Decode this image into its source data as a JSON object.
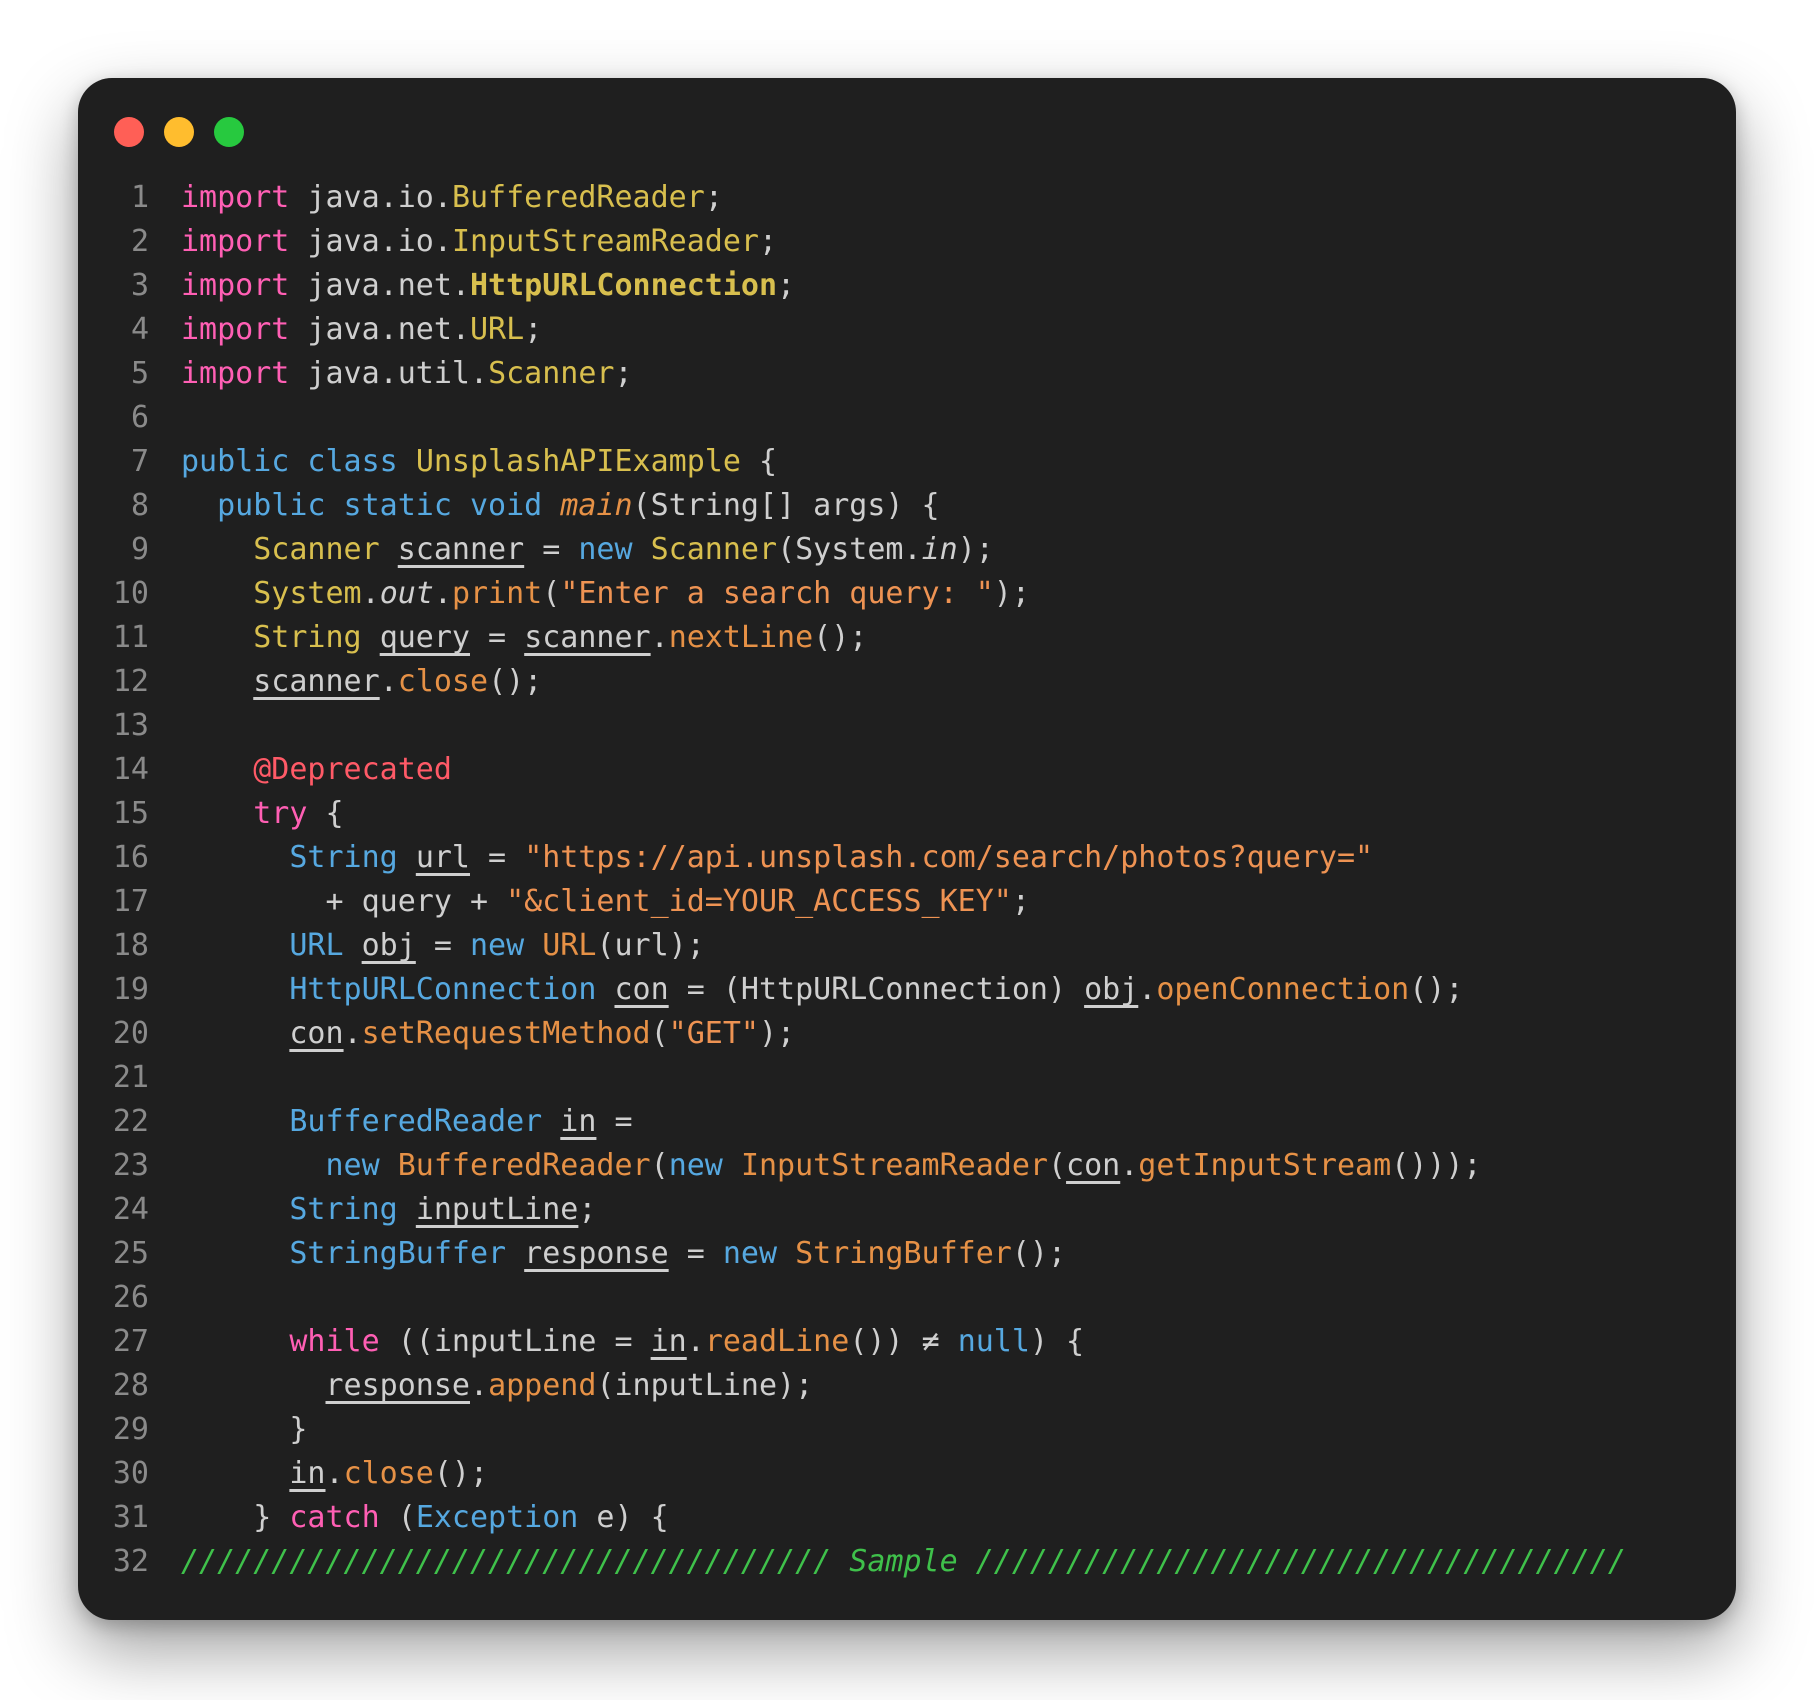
{
  "window": {
    "controls": [
      {
        "name": "close-button",
        "color": "#ff5f56"
      },
      {
        "name": "minimize-button",
        "color": "#ffbd2e"
      },
      {
        "name": "zoom-button",
        "color": "#27c93f"
      }
    ]
  },
  "colors": {
    "background": "#1f1f1f",
    "default": "#cfcfcf",
    "keyword": "#ff5fb4",
    "type_keyword": "#56a8e0",
    "class_name": "#d8bf4e",
    "method": "#e69146",
    "string": "#ee9353",
    "annotation": "#ff5a67",
    "comment": "#3fc14b",
    "line_number": "#8a8a8a"
  },
  "lines": [
    {
      "n": "1",
      "tokens": [
        {
          "t": "import",
          "c": "keyword"
        },
        {
          "t": " java.io.",
          "c": "default"
        },
        {
          "t": "BufferedReader",
          "c": "class_name"
        },
        {
          "t": ";",
          "c": "default"
        }
      ]
    },
    {
      "n": "2",
      "tokens": [
        {
          "t": "import",
          "c": "keyword"
        },
        {
          "t": " java.io.",
          "c": "default"
        },
        {
          "t": "InputStreamReader",
          "c": "class_name"
        },
        {
          "t": ";",
          "c": "default"
        }
      ]
    },
    {
      "n": "3",
      "tokens": [
        {
          "t": "import",
          "c": "keyword"
        },
        {
          "t": " java.net.",
          "c": "default"
        },
        {
          "t": "HttpURLConnection",
          "c": "class_name",
          "s": "b"
        },
        {
          "t": ";",
          "c": "default"
        }
      ]
    },
    {
      "n": "4",
      "tokens": [
        {
          "t": "import",
          "c": "keyword"
        },
        {
          "t": " java.net.",
          "c": "default"
        },
        {
          "t": "URL",
          "c": "class_name"
        },
        {
          "t": ";",
          "c": "default"
        }
      ]
    },
    {
      "n": "5",
      "tokens": [
        {
          "t": "import",
          "c": "keyword"
        },
        {
          "t": " java.util.",
          "c": "default"
        },
        {
          "t": "Scanner",
          "c": "class_name"
        },
        {
          "t": ";",
          "c": "default"
        }
      ]
    },
    {
      "n": "6",
      "tokens": []
    },
    {
      "n": "7",
      "tokens": [
        {
          "t": "public class ",
          "c": "type_keyword"
        },
        {
          "t": "UnsplashAPIExample",
          "c": "class_name"
        },
        {
          "t": " {",
          "c": "default"
        }
      ]
    },
    {
      "n": "8",
      "tokens": [
        {
          "t": "  public static void ",
          "c": "type_keyword"
        },
        {
          "t": "main",
          "c": "method",
          "s": "i"
        },
        {
          "t": "(String[] args) {",
          "c": "default"
        }
      ]
    },
    {
      "n": "9",
      "tokens": [
        {
          "t": "    Scanner ",
          "c": "class_name"
        },
        {
          "t": "scanner",
          "c": "default",
          "s": "u"
        },
        {
          "t": " = ",
          "c": "default"
        },
        {
          "t": "new ",
          "c": "type_keyword"
        },
        {
          "t": "Scanner",
          "c": "class_name"
        },
        {
          "t": "(System.",
          "c": "default"
        },
        {
          "t": "in",
          "c": "default",
          "s": "i"
        },
        {
          "t": ");",
          "c": "default"
        }
      ]
    },
    {
      "n": "10",
      "tokens": [
        {
          "t": "    System",
          "c": "class_name"
        },
        {
          "t": ".",
          "c": "default"
        },
        {
          "t": "out",
          "c": "default",
          "s": "i"
        },
        {
          "t": ".",
          "c": "default"
        },
        {
          "t": "print",
          "c": "method"
        },
        {
          "t": "(",
          "c": "default"
        },
        {
          "t": "\"Enter a search query: \"",
          "c": "string"
        },
        {
          "t": ");",
          "c": "default"
        }
      ]
    },
    {
      "n": "11",
      "tokens": [
        {
          "t": "    String ",
          "c": "class_name"
        },
        {
          "t": "query",
          "c": "default",
          "s": "u"
        },
        {
          "t": " = ",
          "c": "default"
        },
        {
          "t": "scanner",
          "c": "default",
          "s": "u"
        },
        {
          "t": ".",
          "c": "default"
        },
        {
          "t": "nextLine",
          "c": "method"
        },
        {
          "t": "();",
          "c": "default"
        }
      ]
    },
    {
      "n": "12",
      "tokens": [
        {
          "t": "    ",
          "c": "default"
        },
        {
          "t": "scanner",
          "c": "default",
          "s": "u"
        },
        {
          "t": ".",
          "c": "default"
        },
        {
          "t": "close",
          "c": "method"
        },
        {
          "t": "();",
          "c": "default"
        }
      ]
    },
    {
      "n": "13",
      "tokens": []
    },
    {
      "n": "14",
      "tokens": [
        {
          "t": "    @Deprecated",
          "c": "annotation"
        }
      ]
    },
    {
      "n": "15",
      "tokens": [
        {
          "t": "    try",
          "c": "keyword"
        },
        {
          "t": " {",
          "c": "default"
        }
      ]
    },
    {
      "n": "16",
      "tokens": [
        {
          "t": "      String ",
          "c": "type_keyword"
        },
        {
          "t": "url",
          "c": "default",
          "s": "u"
        },
        {
          "t": " = ",
          "c": "default"
        },
        {
          "t": "\"https://api.unsplash.com/search/photos?query=\"",
          "c": "string"
        }
      ]
    },
    {
      "n": "17",
      "tokens": [
        {
          "t": "        + query + ",
          "c": "default"
        },
        {
          "t": "\"&client_id=YOUR_ACCESS_KEY\"",
          "c": "string"
        },
        {
          "t": ";",
          "c": "default"
        }
      ]
    },
    {
      "n": "18",
      "tokens": [
        {
          "t": "      URL ",
          "c": "type_keyword"
        },
        {
          "t": "obj",
          "c": "default",
          "s": "u"
        },
        {
          "t": " = ",
          "c": "default"
        },
        {
          "t": "new ",
          "c": "type_keyword"
        },
        {
          "t": "URL",
          "c": "method"
        },
        {
          "t": "(url);",
          "c": "default"
        }
      ]
    },
    {
      "n": "19",
      "tokens": [
        {
          "t": "      HttpURLConnection ",
          "c": "type_keyword"
        },
        {
          "t": "con",
          "c": "default",
          "s": "u"
        },
        {
          "t": " = (HttpURLConnection) ",
          "c": "default"
        },
        {
          "t": "obj",
          "c": "default",
          "s": "u"
        },
        {
          "t": ".",
          "c": "default"
        },
        {
          "t": "openConnection",
          "c": "method"
        },
        {
          "t": "();",
          "c": "default"
        }
      ]
    },
    {
      "n": "20",
      "tokens": [
        {
          "t": "      ",
          "c": "default"
        },
        {
          "t": "con",
          "c": "default",
          "s": "u"
        },
        {
          "t": ".",
          "c": "default"
        },
        {
          "t": "setRequestMethod",
          "c": "method"
        },
        {
          "t": "(",
          "c": "default"
        },
        {
          "t": "\"GET\"",
          "c": "string"
        },
        {
          "t": ");",
          "c": "default"
        }
      ]
    },
    {
      "n": "21",
      "tokens": []
    },
    {
      "n": "22",
      "tokens": [
        {
          "t": "      BufferedReader ",
          "c": "type_keyword"
        },
        {
          "t": "in",
          "c": "default",
          "s": "u"
        },
        {
          "t": " =",
          "c": "default"
        }
      ]
    },
    {
      "n": "23",
      "tokens": [
        {
          "t": "        new ",
          "c": "type_keyword"
        },
        {
          "t": "BufferedReader",
          "c": "method"
        },
        {
          "t": "(",
          "c": "default"
        },
        {
          "t": "new ",
          "c": "type_keyword"
        },
        {
          "t": "InputStreamReader",
          "c": "method"
        },
        {
          "t": "(",
          "c": "default"
        },
        {
          "t": "con",
          "c": "default",
          "s": "u"
        },
        {
          "t": ".",
          "c": "default"
        },
        {
          "t": "getInputStream",
          "c": "method"
        },
        {
          "t": "()));",
          "c": "default"
        }
      ]
    },
    {
      "n": "24",
      "tokens": [
        {
          "t": "      String ",
          "c": "type_keyword"
        },
        {
          "t": "inputLine",
          "c": "default",
          "s": "u"
        },
        {
          "t": ";",
          "c": "default"
        }
      ]
    },
    {
      "n": "25",
      "tokens": [
        {
          "t": "      StringBuffer ",
          "c": "type_keyword"
        },
        {
          "t": "response",
          "c": "default",
          "s": "u"
        },
        {
          "t": " = ",
          "c": "default"
        },
        {
          "t": "new ",
          "c": "type_keyword"
        },
        {
          "t": "StringBuffer",
          "c": "method"
        },
        {
          "t": "();",
          "c": "default"
        }
      ]
    },
    {
      "n": "26",
      "tokens": []
    },
    {
      "n": "27",
      "tokens": [
        {
          "t": "      while",
          "c": "keyword"
        },
        {
          "t": " ((inputLine = ",
          "c": "default"
        },
        {
          "t": "in",
          "c": "default",
          "s": "u"
        },
        {
          "t": ".",
          "c": "default"
        },
        {
          "t": "readLine",
          "c": "method"
        },
        {
          "t": "()) ≠ ",
          "c": "default"
        },
        {
          "t": "null",
          "c": "type_keyword"
        },
        {
          "t": ") {",
          "c": "default"
        }
      ]
    },
    {
      "n": "28",
      "tokens": [
        {
          "t": "        ",
          "c": "default"
        },
        {
          "t": "response",
          "c": "default",
          "s": "u"
        },
        {
          "t": ".",
          "c": "default"
        },
        {
          "t": "append",
          "c": "method"
        },
        {
          "t": "(inputLine);",
          "c": "default"
        }
      ]
    },
    {
      "n": "29",
      "tokens": [
        {
          "t": "      }",
          "c": "default"
        }
      ]
    },
    {
      "n": "30",
      "tokens": [
        {
          "t": "      ",
          "c": "default"
        },
        {
          "t": "in",
          "c": "default",
          "s": "u"
        },
        {
          "t": ".",
          "c": "default"
        },
        {
          "t": "close",
          "c": "method"
        },
        {
          "t": "();",
          "c": "default"
        }
      ]
    },
    {
      "n": "31",
      "tokens": [
        {
          "t": "    } ",
          "c": "default"
        },
        {
          "t": "catch",
          "c": "keyword"
        },
        {
          "t": " (",
          "c": "default"
        },
        {
          "t": "Exception",
          "c": "type_keyword"
        },
        {
          "t": " e) {",
          "c": "default"
        }
      ]
    },
    {
      "n": "32",
      "tokens": [
        {
          "t": "//////////////////////////////////// Sample ////////////////////////////////////",
          "c": "comment",
          "s": "i"
        }
      ]
    }
  ]
}
